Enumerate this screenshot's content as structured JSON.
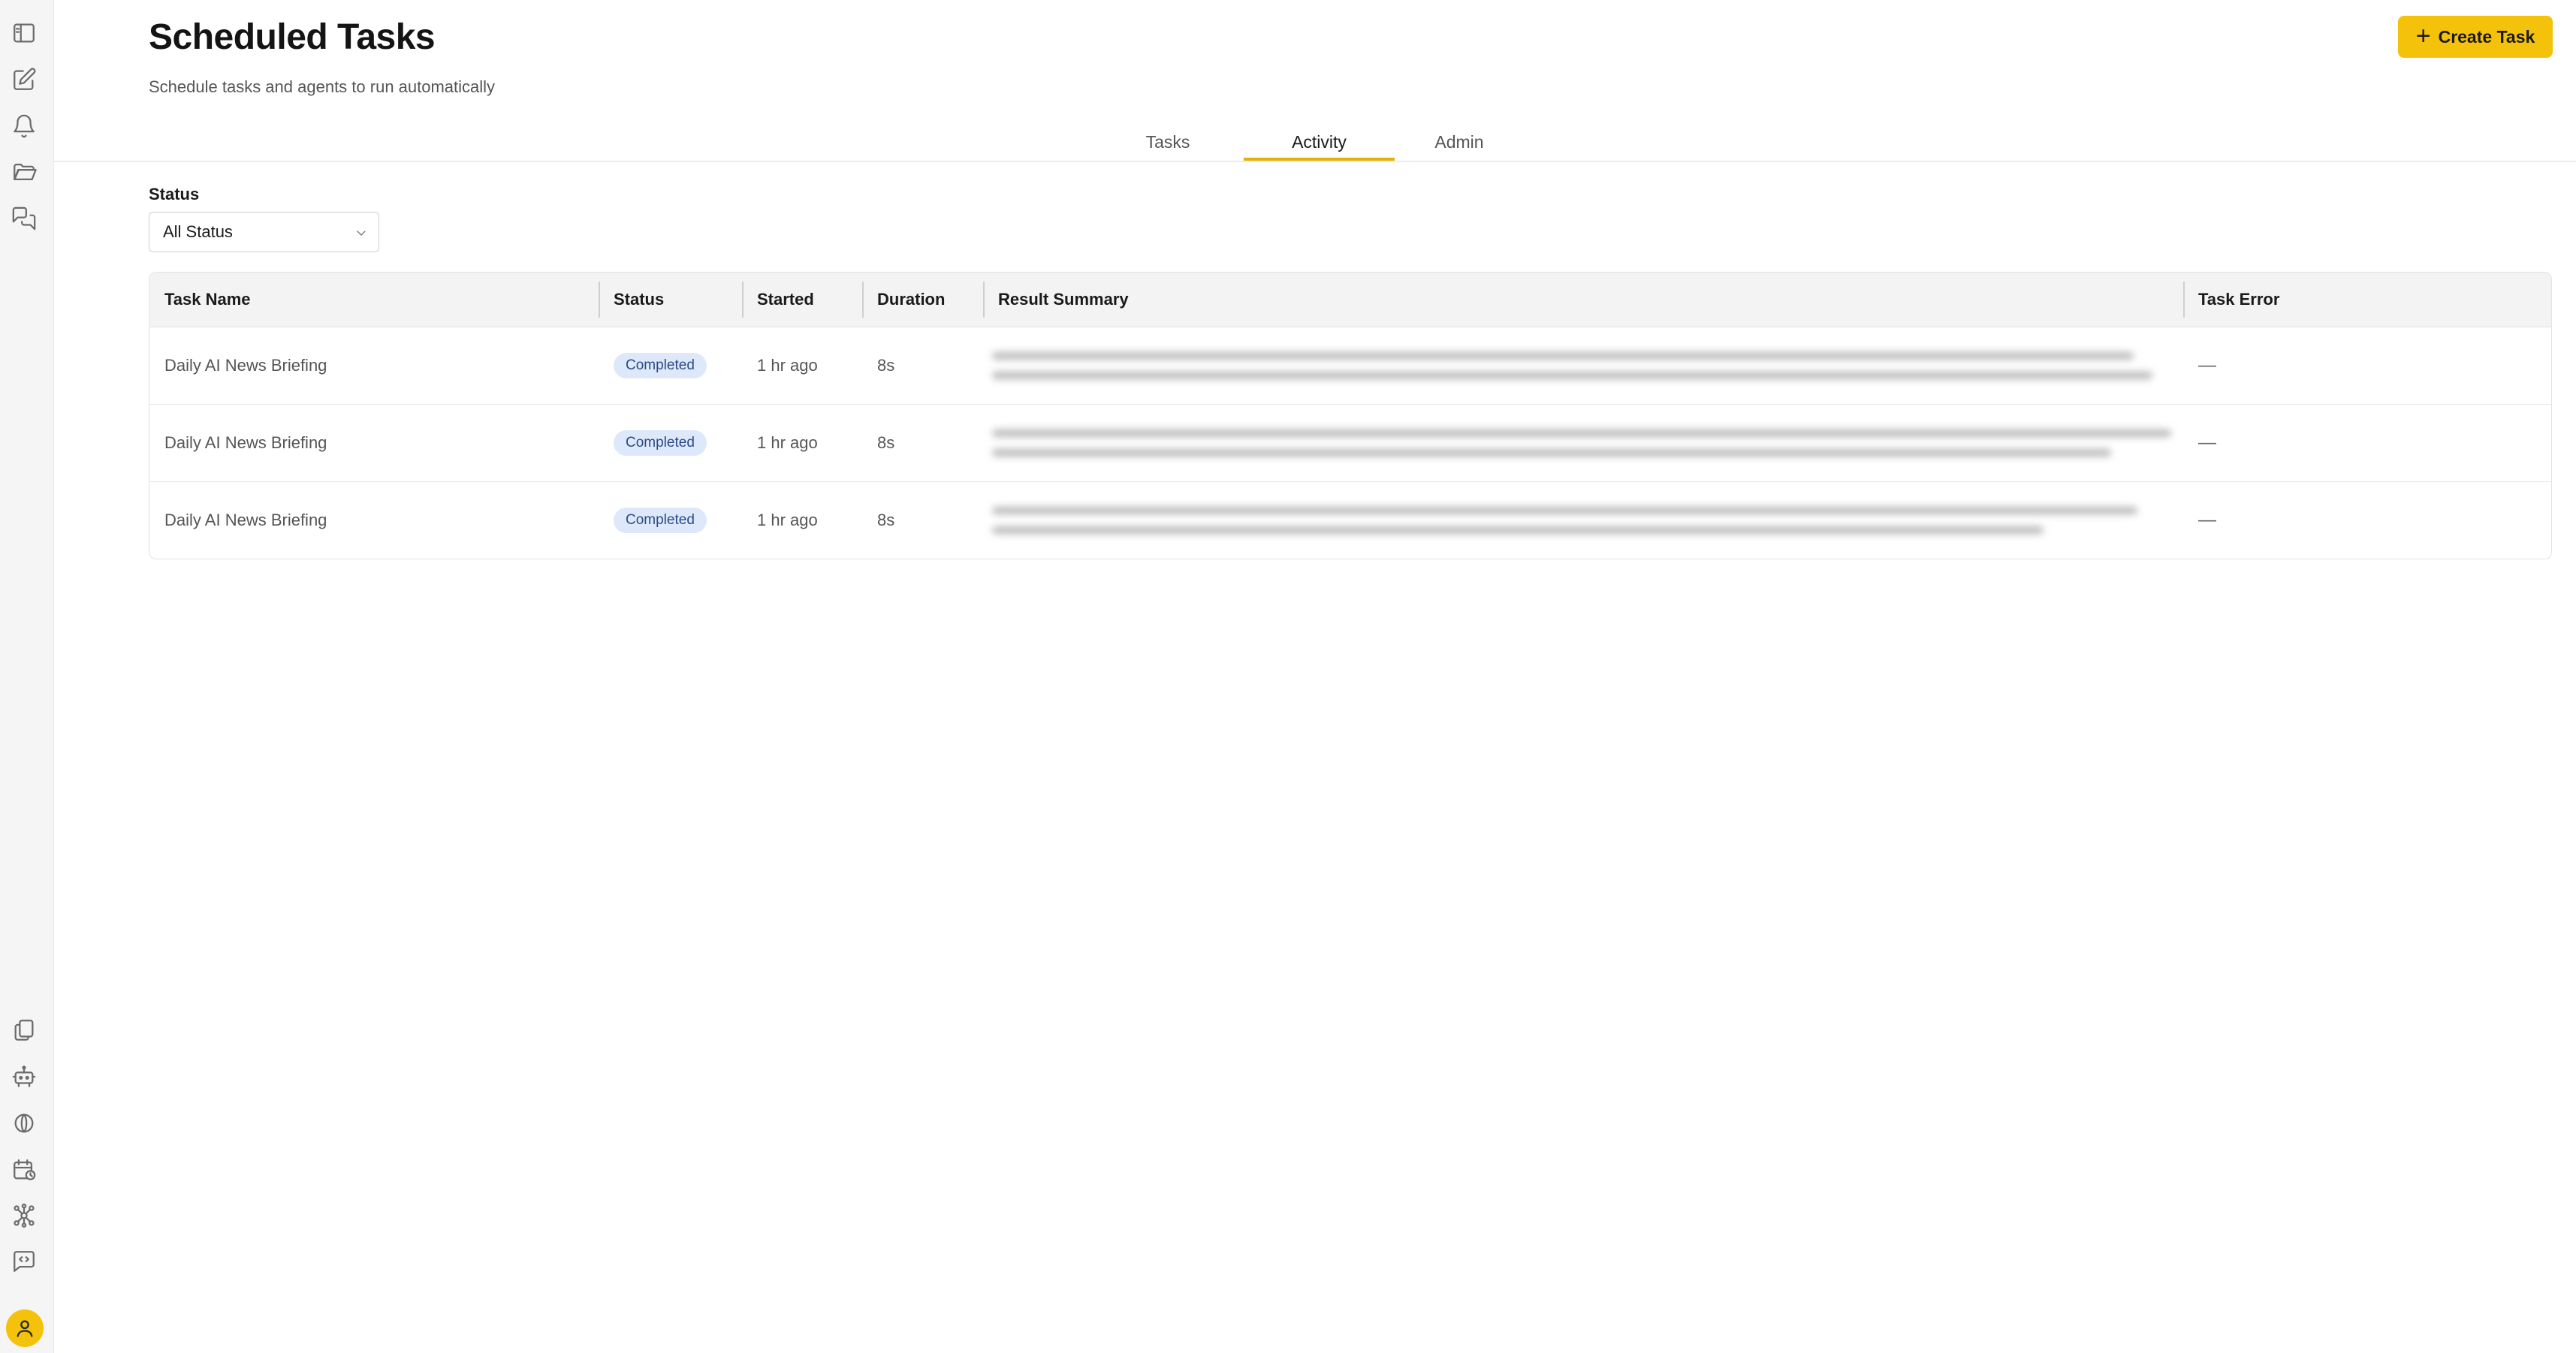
{
  "sidebar": {
    "icons": [
      "sidebar-toggle-icon",
      "edit-icon",
      "bell-icon",
      "folder-icon",
      "chat-icon",
      "documents-icon",
      "robot-icon",
      "brain-icon",
      "calendar-clock-icon",
      "network-icon",
      "code-message-icon"
    ],
    "avatar": "user-icon"
  },
  "header": {
    "title": "Scheduled Tasks",
    "subtitle": "Schedule tasks and agents to run automatically",
    "create_label": "Create Task",
    "create_icon": "plus"
  },
  "tabs": [
    {
      "label": "Tasks",
      "active": false
    },
    {
      "label": "Activity",
      "active": true
    },
    {
      "label": "Admin",
      "active": false
    }
  ],
  "filter": {
    "label": "Status",
    "selected": "All Status"
  },
  "table": {
    "columns": [
      "Task Name",
      "Status",
      "Started",
      "Duration",
      "Result Summary",
      "Task Error"
    ],
    "rows": [
      {
        "task_name": "Daily AI News Briefing",
        "status": "Completed",
        "started": "1 hr ago",
        "duration": "8s",
        "task_error": "—"
      },
      {
        "task_name": "Daily AI News Briefing",
        "status": "Completed",
        "started": "1 hr ago",
        "duration": "8s",
        "task_error": "—"
      },
      {
        "task_name": "Daily AI News Briefing",
        "status": "Completed",
        "started": "1 hr ago",
        "duration": "8s",
        "task_error": "—"
      }
    ]
  },
  "colors": {
    "accent": "#f5c20b",
    "tab_underline": "#e8b005",
    "badge_bg": "#dde8fa",
    "badge_text": "#2c4a85"
  }
}
